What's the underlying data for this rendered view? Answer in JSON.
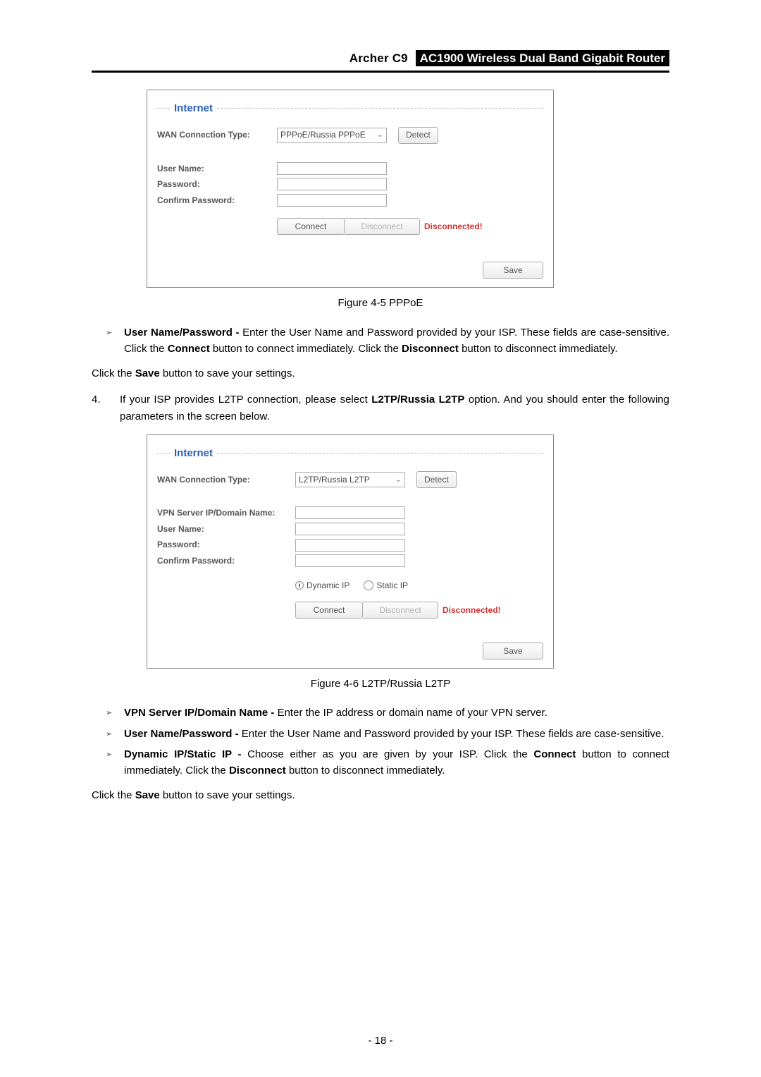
{
  "header": {
    "model": "Archer C9",
    "product": "AC1900 Wireless Dual Band Gigabit Router"
  },
  "panel1": {
    "title": "Internet",
    "wan_label": "WAN Connection Type:",
    "wan_value": "PPPoE/Russia PPPoE",
    "detect": "Detect",
    "username_label": "User Name:",
    "password_label": "Password:",
    "confirm_label": "Confirm Password:",
    "connect": "Connect",
    "disconnect": "Disconnect",
    "status": "Disconnected!",
    "save": "Save"
  },
  "fig1": "Figure 4-5 PPPoE",
  "bullet1": {
    "strong": "User Name/Password -",
    "rest1": " Enter the User Name and Password provided by your ISP. These fields are case-sensitive. Click the ",
    "s2": "Connect",
    "rest2": " button to connect immediately. Click the ",
    "s3": "Disconnect",
    "rest3": " button to disconnect immediately."
  },
  "saveline1a": "Click the ",
  "saveline1b": "Save",
  "saveline1c": " button to save your settings.",
  "step4": {
    "num": "4.",
    "t1": "If your ISP provides L2TP connection, please select ",
    "s1": "L2TP/Russia L2TP",
    "t2": " option. And you should enter the following parameters in the screen below."
  },
  "panel2": {
    "title": "Internet",
    "wan_label": "WAN Connection Type:",
    "wan_value": "L2TP/Russia L2TP",
    "detect": "Detect",
    "vpn_label": "VPN Server IP/Domain Name:",
    "username_label": "User Name:",
    "password_label": "Password:",
    "confirm_label": "Confirm Password:",
    "radio_dyn": "Dynamic IP",
    "radio_stat": "Static IP",
    "connect": "Connect",
    "disconnect": "Disconnect",
    "status": "Disconnected!",
    "save": "Save"
  },
  "fig2": "Figure 4-6 L2TP/Russia L2TP",
  "bullets2": [
    {
      "strong": "VPN Server IP/Domain Name -",
      "rest": " Enter the IP address or domain name of your VPN server."
    },
    {
      "strong": "User Name/Password -",
      "rest": " Enter the User Name and Password provided by your ISP. These fields are case-sensitive."
    }
  ],
  "bullet_dyn": {
    "strong": "Dynamic IP/Static IP -",
    "t1": " Choose either as you are given by your ISP. Click the ",
    "s1": "Connect",
    "t2": " button to connect immediately. Click the ",
    "s2": "Disconnect",
    "t3": " button to disconnect immediately."
  },
  "saveline2a": "Click the ",
  "saveline2b": "Save",
  "saveline2c": " button to save your settings.",
  "page_no": "- 18 -"
}
